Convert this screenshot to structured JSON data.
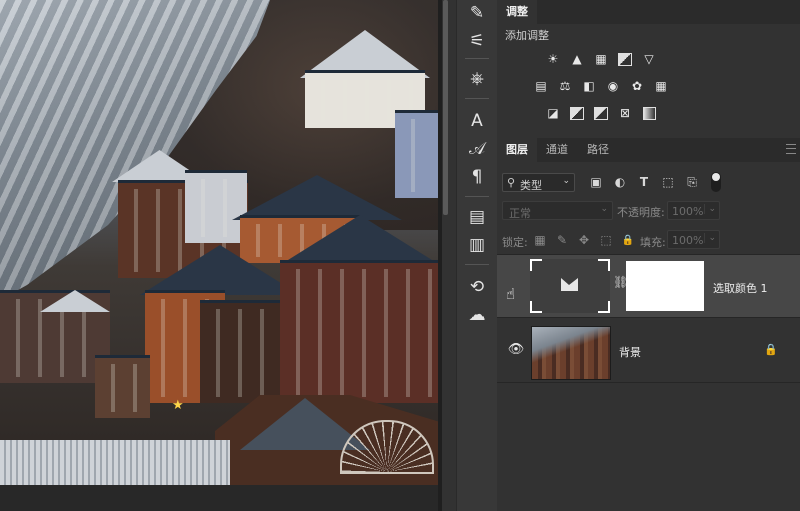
{
  "adjustments_panel": {
    "tab_label": "调整",
    "add_label": "添加调整",
    "rows": [
      [
        {
          "name": "brightness-icon",
          "glyph": "☀"
        },
        {
          "name": "levels-icon",
          "glyph": "▲"
        },
        {
          "name": "curves-icon",
          "glyph": "▦"
        },
        {
          "name": "exposure-icon",
          "glyph": "◩"
        },
        {
          "name": "vibrance-icon",
          "glyph": "▽"
        }
      ],
      [
        {
          "name": "hue-saturation-icon",
          "glyph": "▤"
        },
        {
          "name": "color-balance-icon",
          "glyph": "⚖"
        },
        {
          "name": "black-white-icon",
          "glyph": "◧"
        },
        {
          "name": "photo-filter-icon",
          "glyph": "◉"
        },
        {
          "name": "channel-mixer-icon",
          "glyph": "✿"
        },
        {
          "name": "color-lookup-icon",
          "glyph": "▦"
        }
      ],
      [
        {
          "name": "invert-icon",
          "glyph": "◪"
        },
        {
          "name": "posterize-icon",
          "glyph": "▨"
        },
        {
          "name": "threshold-icon",
          "glyph": "◨"
        },
        {
          "name": "selective-color-icon",
          "glyph": "⊠"
        },
        {
          "name": "gradient-map-icon",
          "glyph": "▥"
        }
      ]
    ]
  },
  "layers_panel": {
    "tabs": [
      "图层",
      "通道",
      "路径"
    ],
    "filter": {
      "label": "类型"
    },
    "filter_icons": [
      {
        "name": "pixel-filter-icon",
        "glyph": "▣"
      },
      {
        "name": "adjustment-filter-icon",
        "glyph": "◐"
      },
      {
        "name": "type-filter-icon",
        "glyph": "T"
      },
      {
        "name": "shape-filter-icon",
        "glyph": "⬚"
      },
      {
        "name": "smart-object-filter-icon",
        "glyph": "⎘"
      }
    ],
    "blend_mode": "正常",
    "opacity": {
      "label": "不透明度:",
      "value": "100%"
    },
    "lock_label": "锁定:",
    "lock_icons": [
      {
        "name": "lock-transparent-icon",
        "glyph": "▦"
      },
      {
        "name": "lock-image-icon",
        "glyph": "✎"
      },
      {
        "name": "lock-position-icon",
        "glyph": "✥"
      },
      {
        "name": "lock-artboard-icon",
        "glyph": "⬚"
      },
      {
        "name": "lock-all-icon",
        "glyph": "🔒"
      }
    ],
    "fill": {
      "label": "填充:",
      "value": "100%"
    },
    "layers": [
      {
        "name": "选取颜色 1",
        "type": "adjustment",
        "visible": true,
        "selected": true
      },
      {
        "name": "背景",
        "type": "background",
        "visible": true,
        "locked": true
      }
    ]
  },
  "tool_column": {
    "tools": [
      {
        "name": "brush-settings-icon",
        "glyph": "✎"
      },
      {
        "name": "brush-presets-icon",
        "glyph": "⚟"
      },
      {
        "name": "clone-source-icon",
        "glyph": "⎈"
      },
      {
        "name": "character-icon",
        "glyph": "A"
      },
      {
        "name": "glyphs-icon",
        "glyph": "𝒜"
      },
      {
        "name": "paragraph-icon",
        "glyph": "¶"
      },
      {
        "name": "properties-icon",
        "glyph": "▤"
      },
      {
        "name": "notes-icon",
        "glyph": "▥"
      },
      {
        "name": "libraries-icon",
        "glyph": "⟲"
      },
      {
        "name": "creative-cloud-icon",
        "glyph": "☁"
      }
    ]
  }
}
